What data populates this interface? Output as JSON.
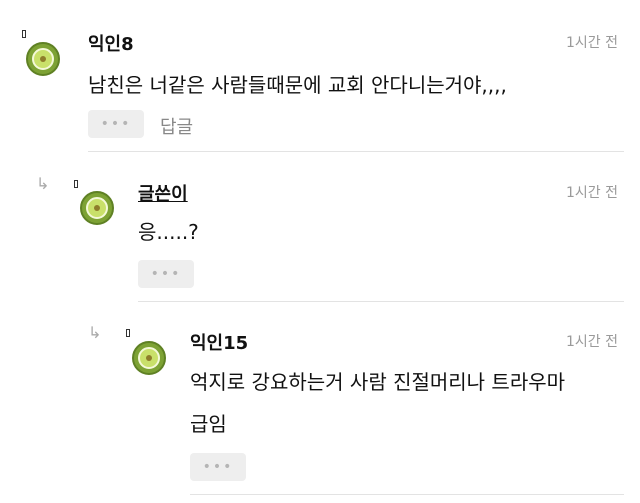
{
  "comments": [
    {
      "author": "익인8",
      "time": "1시간 전",
      "text": "남친은 너같은 사람들때문에 교회 안다니는거야,,,,",
      "more": "•••",
      "reply_label": "답글"
    },
    {
      "author": "글쓴이",
      "time": "1시간 전",
      "text": "응.....?",
      "more": "•••"
    },
    {
      "author": "익인15",
      "time": "1시간 전",
      "text_line1": "억지로 강요하는거 사람 진절머리나 트라우마",
      "text_line2": "급임",
      "more": "•••"
    }
  ],
  "icons": {
    "reply_arrow": "reply-arrow-icon",
    "avatar": "kiwi-avatar-icon"
  },
  "colors": {
    "time": "#9a9a9a",
    "more_button_bg": "#eeeeee",
    "avatar_green": "#7da234"
  }
}
